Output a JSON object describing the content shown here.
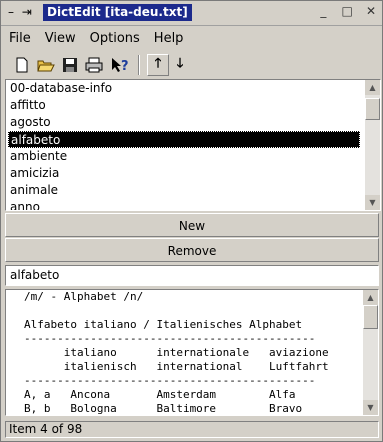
{
  "window": {
    "title": "DictEdit [ita-deu.txt]",
    "left_icons": [
      "–",
      "⇥"
    ],
    "controls": [
      "_",
      "□",
      "✕"
    ]
  },
  "menu": [
    {
      "name": "menu-file",
      "label": "File"
    },
    {
      "name": "menu-view",
      "label": "View"
    },
    {
      "name": "menu-options",
      "label": "Options"
    },
    {
      "name": "menu-help",
      "label": "Help"
    }
  ],
  "toolbar": {
    "new_icon": "new-document-icon",
    "open_icon": "open-folder-icon",
    "save_icon": "save-disk-icon",
    "print_icon": "print-icon",
    "help_icon": "whats-this-help-icon",
    "up_label": "🡑",
    "down_label": "🡓"
  },
  "entries": [
    "00-database-info",
    "affitto",
    "agosto",
    "alfabeto",
    "ambiente",
    "amicizia",
    "animale",
    "anno"
  ],
  "selected_index": 3,
  "buttons": {
    "new_label": "New",
    "remove_label": "Remove"
  },
  "headword": "alfabeto",
  "definition_lines": [
    "/m/ - Alphabet /n/",
    "",
    "Alfabeto italiano / Italienisches Alphabet",
    "--------------------------------------------",
    "      italiano      internationale   aviazione",
    "      italienisch   international    Luftfahrt",
    "--------------------------------------------",
    "A, a   Ancona       Amsterdam        Alfa",
    "B, b   Bologna      Baltimore        Bravo"
  ],
  "status": "Item 4 of 98",
  "list_scroll_fraction": 0.05,
  "text_scroll_fraction": 0.0
}
